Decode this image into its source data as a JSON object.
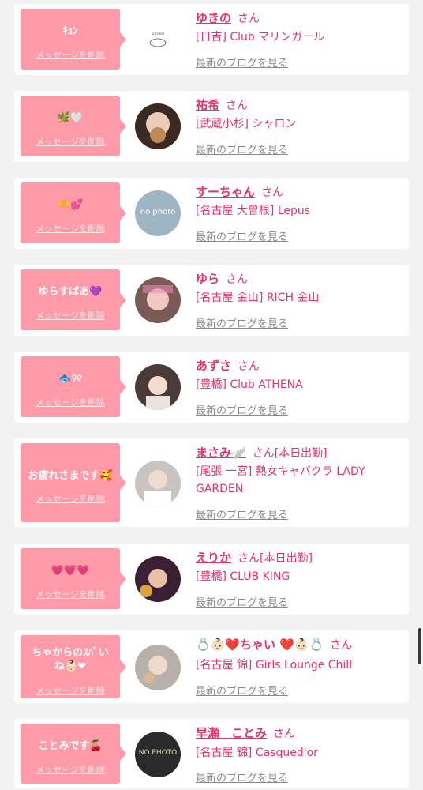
{
  "common": {
    "delete_label": "メッセージを削除",
    "blog_label": "最新のブログを見る",
    "san": "さん"
  },
  "cards": [
    {
      "message": "ｷｭﾝ",
      "name": "ゆきの",
      "status": "",
      "shop": "[日吉] Club マリンガール",
      "avatar_text": "",
      "avatar_bg": "#ffffff"
    },
    {
      "message": "🌿🤍",
      "name": "祐希",
      "status": "",
      "shop": "[武蔵小杉] シャロン",
      "avatar_text": "",
      "avatar_bg": "#3a2a22"
    },
    {
      "message": "🫶💕",
      "name": "すーちゃん",
      "status": "",
      "shop": "[名古屋 大曽根] Lepus",
      "avatar_text": "no photo",
      "avatar_bg": "#9fb5c4"
    },
    {
      "message": "ゆらすばあ💜",
      "name": "ゆら",
      "status": "",
      "shop": "[名古屋 金山] RICH 金山",
      "avatar_text": "",
      "avatar_bg": "#7a5a55"
    },
    {
      "message": "🐟୨୧",
      "name": "あずさ",
      "status": "",
      "shop": "[豊橋] Club ATHENA",
      "avatar_text": "",
      "avatar_bg": "#4b3a3a"
    },
    {
      "message": "お疲れさまです🥰",
      "name": "まさみ🪽",
      "status": "[本日出勤]",
      "shop": "[尾張 一宮] 熟女キャバクラ LADY GARDEN",
      "avatar_text": "",
      "avatar_bg": "#c9c4c0"
    },
    {
      "message": "💗💗💗",
      "name": "えりか",
      "status": "[本日出勤]",
      "shop": "[豊橋] CLUB KING",
      "avatar_text": "",
      "avatar_bg": "#3b2035"
    },
    {
      "message": "ちゃからのｽﾊﾟいね👶🏻❤",
      "name": "💍👶🏻❤️ちゃい ❤️👶🏻💍",
      "status": "",
      "shop": "[名古屋 錦] Girls Lounge Chill",
      "avatar_text": "",
      "avatar_bg": "#b8b0aa"
    },
    {
      "message": "ことみです🍒",
      "name": "早瀬　ことみ",
      "status": "",
      "shop": "[名古屋 錦] Casqued'or",
      "avatar_text": "NO PHOTO",
      "avatar_bg": "#2a2a2a"
    }
  ],
  "colors": {
    "accent": "#e4336a",
    "bubble": "#ff9aa8",
    "background": "#f2f2f2",
    "card": "#ffffff"
  }
}
